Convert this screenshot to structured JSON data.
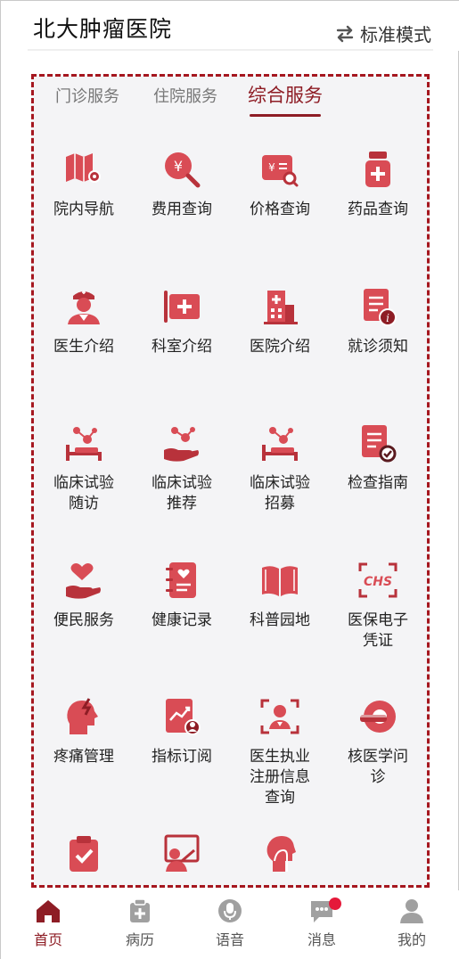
{
  "header": {
    "title": "北大肿瘤医院",
    "mode_label": "标准模式",
    "mode_icon": "swap-arrows-icon"
  },
  "tabs": [
    {
      "label": "门诊服务",
      "active": false
    },
    {
      "label": "住院服务",
      "active": false
    },
    {
      "label": "综合服务",
      "active": true
    }
  ],
  "accent_color": "#a5171f",
  "icon_color": "#d94c55",
  "grid": [
    {
      "label": "院内导航",
      "icon": "map-pin-icon"
    },
    {
      "label": "费用查询",
      "icon": "yen-search-icon"
    },
    {
      "label": "价格查询",
      "icon": "price-search-icon"
    },
    {
      "label": "药品查询",
      "icon": "medicine-bottle-icon"
    },
    {
      "label": "医生介绍",
      "icon": "nurse-icon"
    },
    {
      "label": "科室介绍",
      "icon": "department-sign-icon"
    },
    {
      "label": "医院介绍",
      "icon": "hospital-building-icon"
    },
    {
      "label": "就诊须知",
      "icon": "info-document-icon"
    },
    {
      "label": "临床试验随访",
      "icon": "bed-molecule-icon"
    },
    {
      "label": "临床试验推荐",
      "icon": "hand-molecule-icon"
    },
    {
      "label": "临床试验招募",
      "icon": "bed-molecule-icon"
    },
    {
      "label": "检查指南",
      "icon": "checklist-document-icon"
    },
    {
      "label": "便民服务",
      "icon": "hand-heart-icon"
    },
    {
      "label": "健康记录",
      "icon": "notebook-heart-icon"
    },
    {
      "label": "科普园地",
      "icon": "open-book-icon"
    },
    {
      "label": "医保电子凭证",
      "icon": "chs-scan-icon"
    },
    {
      "label": "疼痛管理",
      "icon": "head-pain-icon"
    },
    {
      "label": "指标订阅",
      "icon": "chart-user-icon"
    },
    {
      "label": "医生执业注册信息查询",
      "icon": "doctor-scan-icon"
    },
    {
      "label": "核医学问诊",
      "icon": "scanner-icon"
    },
    {
      "label": "",
      "icon": "clipboard-check-icon"
    },
    {
      "label": "",
      "icon": "teacher-board-icon"
    },
    {
      "label": "",
      "icon": "throat-head-icon"
    }
  ],
  "tabbar": [
    {
      "label": "首页",
      "icon": "home-icon",
      "active": true,
      "badge": false
    },
    {
      "label": "病历",
      "icon": "medical-record-icon",
      "active": false,
      "badge": false
    },
    {
      "label": "语音",
      "icon": "microphone-icon",
      "active": false,
      "badge": false
    },
    {
      "label": "消息",
      "icon": "message-icon",
      "active": false,
      "badge": true
    },
    {
      "label": "我的",
      "icon": "profile-icon",
      "active": false,
      "badge": false
    }
  ]
}
